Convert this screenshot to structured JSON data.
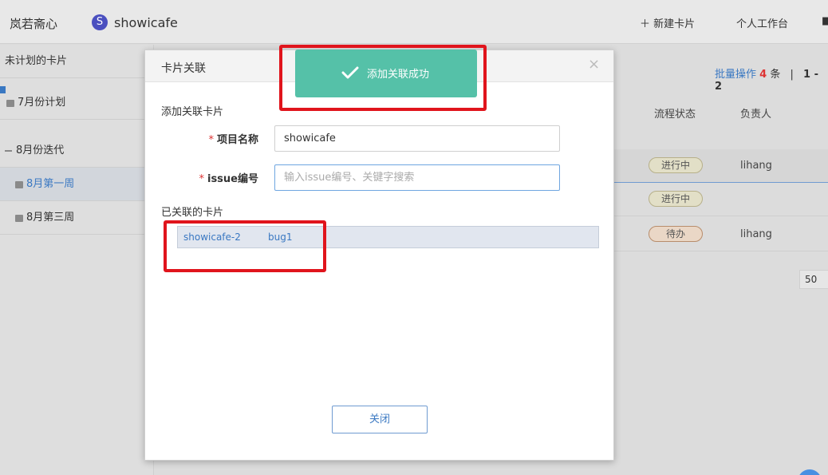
{
  "topbar": {
    "brand": "岚若斋心",
    "project_icon_letter": "S",
    "project_name": "showicafe",
    "new_card": "新建卡片",
    "workspace": "个人工作台"
  },
  "sidebar": {
    "items": [
      {
        "label": "未计划的卡片"
      },
      {
        "label": "7月份计划"
      },
      {
        "label": "8月份迭代"
      },
      {
        "label": "8月第一周"
      },
      {
        "label": "8月第三周"
      }
    ]
  },
  "table": {
    "batch_label": "批量操作",
    "batch_count": "4",
    "batch_unit": "条",
    "separator": "|",
    "pagination": "1 - 2",
    "col_status": "流程状态",
    "col_owner": "负责人",
    "rows": [
      {
        "status": "进行中",
        "owner": "lihang"
      },
      {
        "status": "进行中",
        "owner": ""
      },
      {
        "status": "待办",
        "owner": "lihang"
      }
    ],
    "page_size": "50"
  },
  "modal": {
    "title": "卡片关联",
    "close_glyph": "×",
    "add_section": "添加关联卡片",
    "required_mark": "*",
    "project_label": "项目名称",
    "project_value": "showicafe",
    "issue_label": "issue编号",
    "issue_placeholder": "输入issue编号、关键字搜索",
    "linked_section": "已关联的卡片",
    "linked": [
      {
        "key": "showicafe-2",
        "name": "bug1"
      }
    ],
    "close_button": "关闭"
  },
  "toast": {
    "message": "添加关联成功",
    "color": "#55c1a8"
  },
  "annotation_color": "#e0141c"
}
